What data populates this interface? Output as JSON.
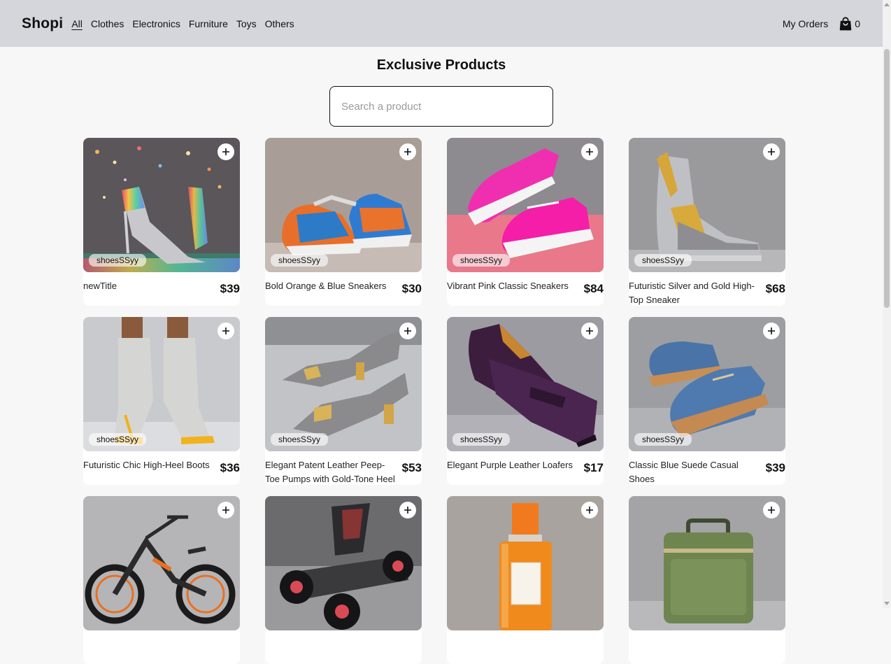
{
  "nav": {
    "brand": "Shopi",
    "categories": [
      "All",
      "Clothes",
      "Electronics",
      "Furniture",
      "Toys",
      "Others"
    ],
    "my_orders": "My Orders",
    "cart_count": "0"
  },
  "page": {
    "title": "Exclusive Products",
    "search_placeholder": "Search a product"
  },
  "products": [
    {
      "name": "newTitle",
      "price": "$39",
      "category": "shoesSSyy",
      "image": "rainbow-high-heels"
    },
    {
      "name": "Bold Orange & Blue Sneakers",
      "price": "$30",
      "category": "shoesSSyy",
      "image": "orange-blue-sneakers"
    },
    {
      "name": "Vibrant Pink Classic Sneakers",
      "price": "$84",
      "category": "shoesSSyy",
      "image": "pink-sneakers"
    },
    {
      "name": "Futuristic Silver and Gold High-Top Sneaker",
      "price": "$68",
      "category": "shoesSSyy",
      "image": "silver-gold-boot"
    },
    {
      "name": "Futuristic Chic High-Heel Boots",
      "price": "$36",
      "category": "shoesSSyy",
      "image": "grey-high-heel-boots"
    },
    {
      "name": "Elegant Patent Leather Peep-Toe Pumps with Gold-Tone Heel",
      "price": "$53",
      "category": "shoesSSyy",
      "image": "grey-peep-toe-pumps"
    },
    {
      "name": "Elegant Purple Leather Loafers",
      "price": "$17",
      "category": "shoesSSyy",
      "image": "purple-loafers"
    },
    {
      "name": "Classic Blue Suede Casual Shoes",
      "price": "$39",
      "category": "shoesSSyy",
      "image": "blue-suede-shoes"
    },
    {
      "image": "electric-bike"
    },
    {
      "image": "go-kart"
    },
    {
      "image": "perfume-bottle"
    },
    {
      "image": "green-suitcase"
    }
  ],
  "colors": {
    "navbar_bg": "#d4d6dc",
    "page_bg": "#f7f7f7"
  }
}
